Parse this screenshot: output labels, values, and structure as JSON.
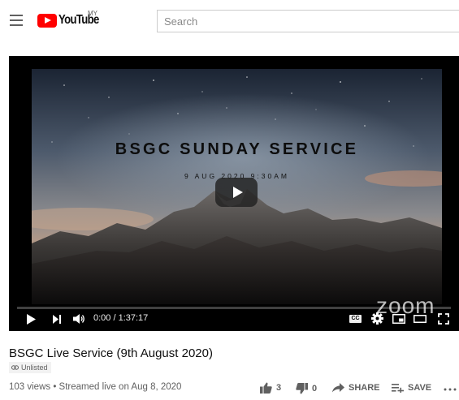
{
  "masthead": {
    "logo_text": "YouTube",
    "country_code": "MY",
    "search_placeholder": "Search"
  },
  "player": {
    "overlay_title": "BSGC SUNDAY SERVICE",
    "overlay_date": "9 AUG 2020 9:30AM",
    "watermark": "zoom",
    "time_display": "0:00 / 1:37:17",
    "progress_fraction": 0,
    "captions_label": "CC"
  },
  "video": {
    "title": "BSGC Live Service (9th August 2020)",
    "badge": "Unlisted",
    "meta": "103 views • Streamed live on Aug 8, 2020",
    "like_count": "3",
    "dislike_count": "0",
    "share_label": "SHARE",
    "save_label": "SAVE"
  },
  "icons": [
    "menu-icon",
    "youtube-logo-icon",
    "play-icon",
    "next-icon",
    "volume-icon",
    "cc-icon",
    "settings-icon",
    "miniplayer-icon",
    "theater-icon",
    "fullscreen-icon",
    "link-icon",
    "thumbs-up-icon",
    "thumbs-down-icon",
    "share-icon",
    "save-icon",
    "more-icon"
  ],
  "colors": {
    "brand_red": "#ff0000",
    "text_primary": "#0f0f0f",
    "text_secondary": "#606060"
  }
}
